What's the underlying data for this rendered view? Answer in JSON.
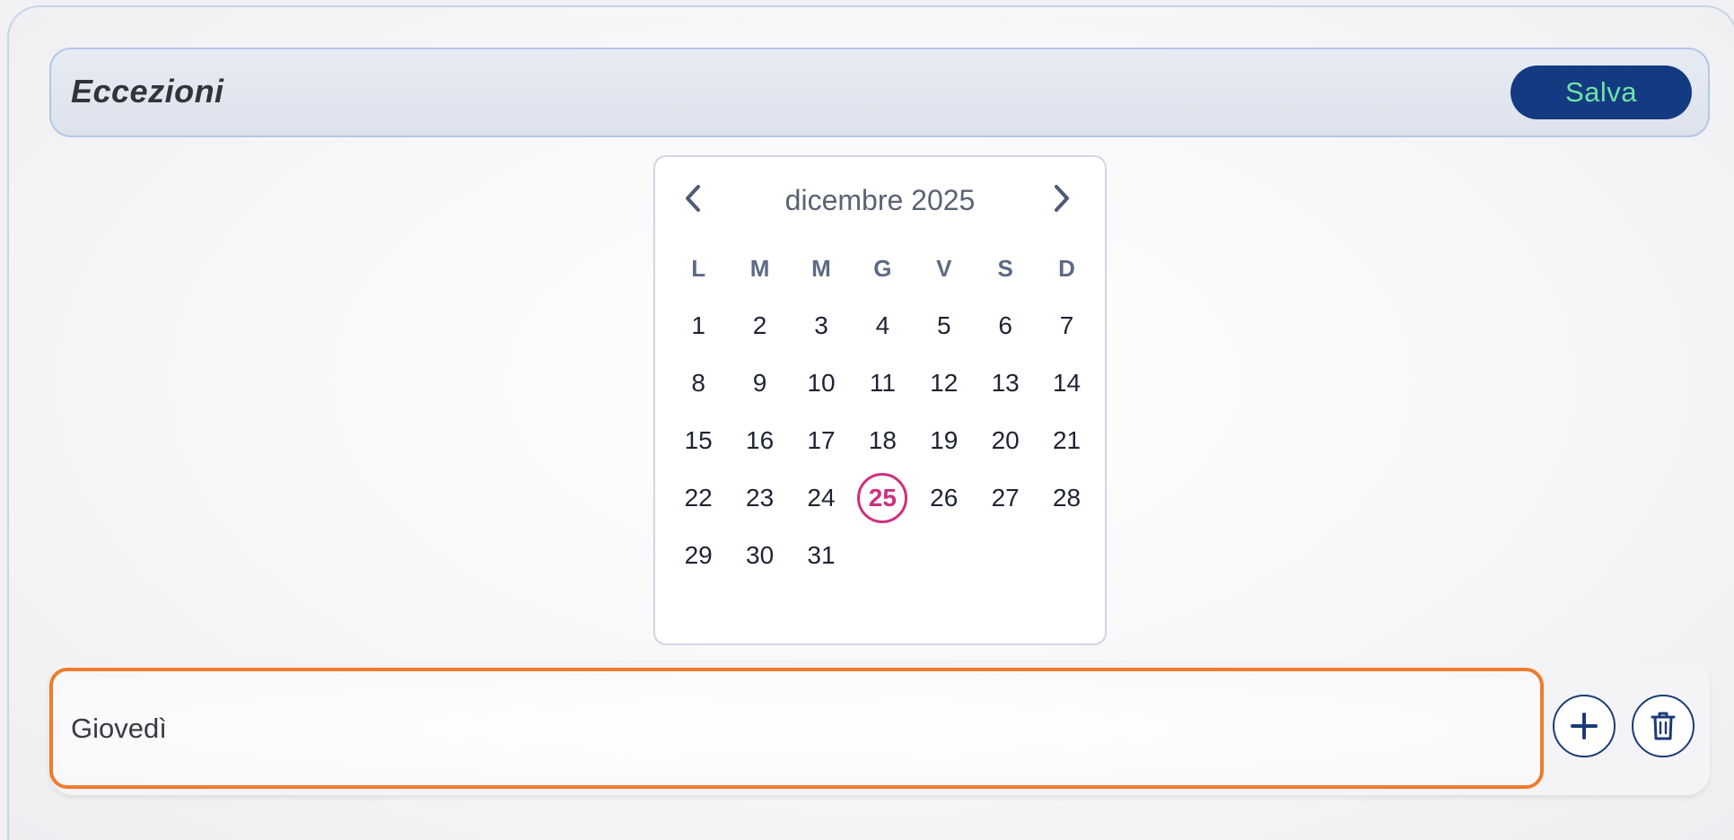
{
  "header": {
    "title": "Eccezioni",
    "save_label": "Salva"
  },
  "calendar": {
    "month_label": "dicembre 2025",
    "prev_icon": "chevron-left-icon",
    "next_icon": "chevron-right-icon",
    "weekdays": [
      "L",
      "M",
      "M",
      "G",
      "V",
      "S",
      "D"
    ],
    "first_weekday_offset": 0,
    "days": [
      "1",
      "2",
      "3",
      "4",
      "5",
      "6",
      "7",
      "8",
      "9",
      "10",
      "11",
      "12",
      "13",
      "14",
      "15",
      "16",
      "17",
      "18",
      "19",
      "20",
      "21",
      "22",
      "23",
      "24",
      "25",
      "26",
      "27",
      "28",
      "29",
      "30",
      "31"
    ],
    "selected_day": "25"
  },
  "exception": {
    "day_value": "Giovedì",
    "add_icon": "plus-icon",
    "delete_icon": "trash-icon"
  },
  "colors": {
    "save_bg": "#143a82",
    "save_text": "#6fe3a6",
    "selected_day": "#d02f7d",
    "input_border": "#ee7c2d",
    "icon_button_border": "#1d3a78"
  }
}
